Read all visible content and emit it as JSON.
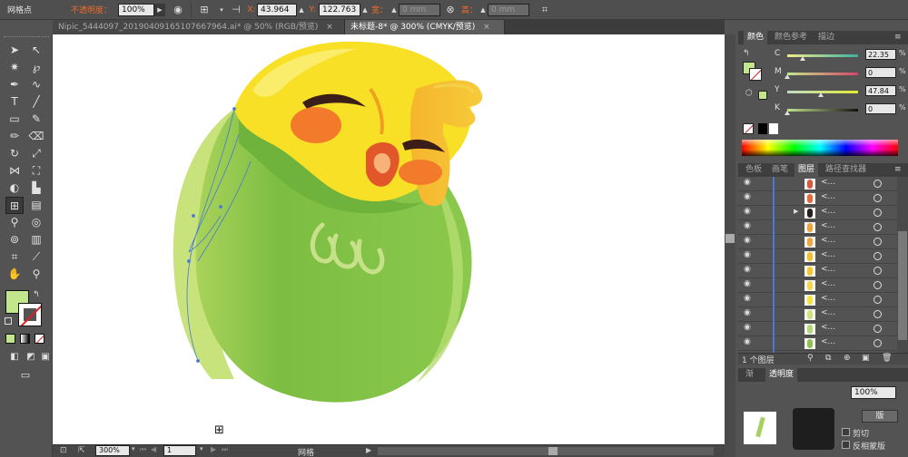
{
  "control_bar": {
    "tool_label": "网格点",
    "opacity_label": "不透明度：",
    "opacity_value": "100%",
    "x_label": "X:",
    "x_value": "43.964",
    "y_label": "Y:",
    "y_value": "122.763",
    "width_label": "宽：",
    "width_value": "0 mm",
    "height_label": "高：",
    "height_value": "0 mm"
  },
  "document_tabs": [
    {
      "label": "Nipic_5444097_20190409165107667964.ai* @ 50% (RGB/预览)",
      "active": false
    },
    {
      "label": "未标题-8* @ 300% (CMYK/预览)",
      "active": true
    }
  ],
  "tab_close": "×",
  "color_panel": {
    "tabs": [
      "颜色",
      "颜色参考",
      "描边"
    ],
    "channels": [
      {
        "name": "C",
        "value": "22.35",
        "unit": "%",
        "position": 0.22,
        "gradient": "linear-gradient(to right,#f0ec8a,#3fb0a0)"
      },
      {
        "name": "M",
        "value": "0",
        "unit": "%",
        "position": 0.0,
        "gradient": "linear-gradient(to right,#c6e58b,#d2486a)"
      },
      {
        "name": "Y",
        "value": "47.84",
        "unit": "%",
        "position": 0.48,
        "gradient": "linear-gradient(to right,#c0dcc8,#e2ec30)"
      },
      {
        "name": "K",
        "value": "0",
        "unit": "%",
        "position": 0.0,
        "gradient": "linear-gradient(to right,#c3e38e,#111111)"
      }
    ]
  },
  "layers_panel": {
    "tabs": [
      "色板",
      "画笔",
      "图层",
      "路径查找器"
    ],
    "rows": [
      {
        "name": "<...",
        "thumb": "#d95a3a",
        "expand": false
      },
      {
        "name": "<...",
        "thumb": "#e86a3c",
        "expand": false
      },
      {
        "name": "<...",
        "thumb": "#2b1d1d",
        "expand": true
      },
      {
        "name": "<...",
        "thumb": "#f1a23b",
        "expand": false
      },
      {
        "name": "<...",
        "thumb": "#f3a73a",
        "expand": false
      },
      {
        "name": "<...",
        "thumb": "#f5c026",
        "expand": false
      },
      {
        "name": "<...",
        "thumb": "#f5c828",
        "expand": false
      },
      {
        "name": "<...",
        "thumb": "#f2d84b",
        "expand": false
      },
      {
        "name": "<...",
        "thumb": "#f5e23a",
        "expand": false
      },
      {
        "name": "<...",
        "thumb": "#cfe27a",
        "expand": false
      },
      {
        "name": "<...",
        "thumb": "#b4d872",
        "expand": false
      },
      {
        "name": "<...",
        "thumb": "#8ec44d",
        "expand": false
      },
      {
        "name": "<...",
        "thumb": "#a8d060",
        "expand": false
      }
    ],
    "footer_label": "1 个图层"
  },
  "lower_panel": {
    "tabs": [
      "渐",
      "透明度"
    ],
    "opacity_value": "100%",
    "button_label": "版",
    "checkbox_1": "剪切",
    "checkbox_2": "反相蒙版"
  },
  "status_bar": {
    "zoom": "300%",
    "page": "1",
    "tool_name": "网格"
  },
  "colors": {
    "fill_swatch": "#c3e58b",
    "accent_blue": "#4a78d8"
  }
}
